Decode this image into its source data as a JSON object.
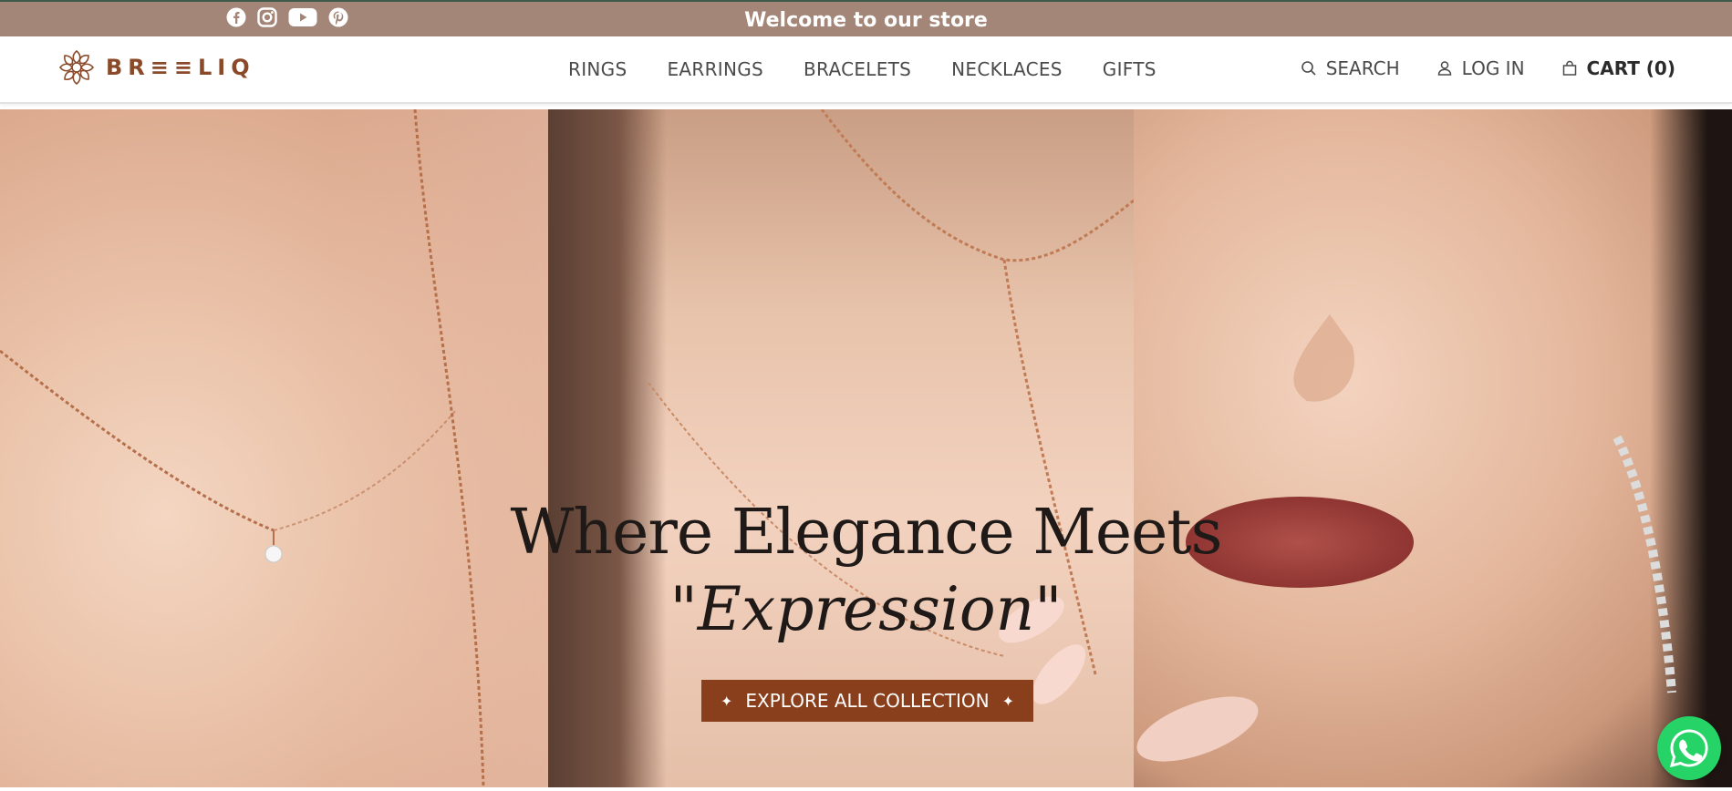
{
  "topbar": {
    "welcome": "Welcome to our store",
    "social": [
      "facebook-icon",
      "instagram-icon",
      "youtube-icon",
      "pinterest-icon"
    ]
  },
  "header": {
    "logo_text": "BR≡≡LIQ",
    "nav": [
      "RINGS",
      "EARRINGS",
      "BRACELETS",
      "NECKLACES",
      "GIFTS"
    ],
    "search": "SEARCH",
    "login": "LOG IN",
    "cart": "CART (0)"
  },
  "hero": {
    "headline": "Where Elegance Meets",
    "subheadline": "\"Expression\"",
    "cta_label": "EXPLORE ALL COLLECTION",
    "cta_sparkle": "✦"
  },
  "colors": {
    "topbar": "#a38677",
    "brand": "#8a4a2a",
    "cta": "#8a3f1c",
    "whatsapp": "#25d366"
  }
}
